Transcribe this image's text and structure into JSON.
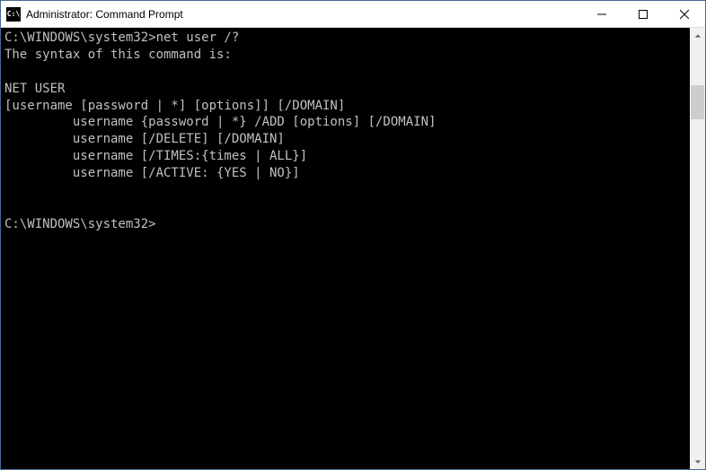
{
  "titlebar": {
    "icon_label": "C:\\",
    "title": "Administrator: Command Prompt"
  },
  "terminal": {
    "prompt1": "C:\\WINDOWS\\system32>",
    "command1": "net user /?",
    "line_syntax": "The syntax of this command is:",
    "line_blank1": "",
    "line_netuser": "NET USER",
    "line_usage1": "[username [password | *] [options]] [/DOMAIN]",
    "line_usage2": "         username {password | *} /ADD [options] [/DOMAIN]",
    "line_usage3": "         username [/DELETE] [/DOMAIN]",
    "line_usage4": "         username [/TIMES:{times | ALL}]",
    "line_usage5": "         username [/ACTIVE: {YES | NO}]",
    "line_blank2": "",
    "line_blank3": "",
    "prompt2": "C:\\WINDOWS\\system32>"
  }
}
